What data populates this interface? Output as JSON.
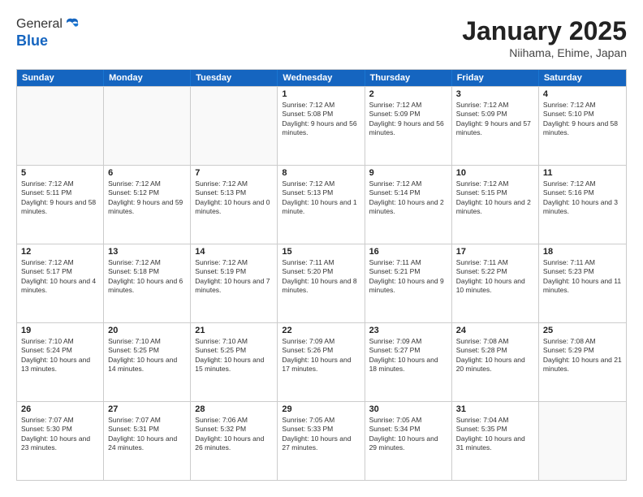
{
  "header": {
    "logo_general": "General",
    "logo_blue": "Blue",
    "month_title": "January 2025",
    "location": "Niihama, Ehime, Japan"
  },
  "days_of_week": [
    "Sunday",
    "Monday",
    "Tuesday",
    "Wednesday",
    "Thursday",
    "Friday",
    "Saturday"
  ],
  "weeks": [
    [
      {
        "day": "",
        "empty": true
      },
      {
        "day": "",
        "empty": true
      },
      {
        "day": "",
        "empty": true
      },
      {
        "day": "1",
        "sunrise": "7:12 AM",
        "sunset": "5:08 PM",
        "daylight": "9 hours and 56 minutes."
      },
      {
        "day": "2",
        "sunrise": "7:12 AM",
        "sunset": "5:09 PM",
        "daylight": "9 hours and 56 minutes."
      },
      {
        "day": "3",
        "sunrise": "7:12 AM",
        "sunset": "5:09 PM",
        "daylight": "9 hours and 57 minutes."
      },
      {
        "day": "4",
        "sunrise": "7:12 AM",
        "sunset": "5:10 PM",
        "daylight": "9 hours and 58 minutes."
      }
    ],
    [
      {
        "day": "5",
        "sunrise": "7:12 AM",
        "sunset": "5:11 PM",
        "daylight": "9 hours and 58 minutes."
      },
      {
        "day": "6",
        "sunrise": "7:12 AM",
        "sunset": "5:12 PM",
        "daylight": "9 hours and 59 minutes."
      },
      {
        "day": "7",
        "sunrise": "7:12 AM",
        "sunset": "5:13 PM",
        "daylight": "10 hours and 0 minutes."
      },
      {
        "day": "8",
        "sunrise": "7:12 AM",
        "sunset": "5:13 PM",
        "daylight": "10 hours and 1 minute."
      },
      {
        "day": "9",
        "sunrise": "7:12 AM",
        "sunset": "5:14 PM",
        "daylight": "10 hours and 2 minutes."
      },
      {
        "day": "10",
        "sunrise": "7:12 AM",
        "sunset": "5:15 PM",
        "daylight": "10 hours and 2 minutes."
      },
      {
        "day": "11",
        "sunrise": "7:12 AM",
        "sunset": "5:16 PM",
        "daylight": "10 hours and 3 minutes."
      }
    ],
    [
      {
        "day": "12",
        "sunrise": "7:12 AM",
        "sunset": "5:17 PM",
        "daylight": "10 hours and 4 minutes."
      },
      {
        "day": "13",
        "sunrise": "7:12 AM",
        "sunset": "5:18 PM",
        "daylight": "10 hours and 6 minutes."
      },
      {
        "day": "14",
        "sunrise": "7:12 AM",
        "sunset": "5:19 PM",
        "daylight": "10 hours and 7 minutes."
      },
      {
        "day": "15",
        "sunrise": "7:11 AM",
        "sunset": "5:20 PM",
        "daylight": "10 hours and 8 minutes."
      },
      {
        "day": "16",
        "sunrise": "7:11 AM",
        "sunset": "5:21 PM",
        "daylight": "10 hours and 9 minutes."
      },
      {
        "day": "17",
        "sunrise": "7:11 AM",
        "sunset": "5:22 PM",
        "daylight": "10 hours and 10 minutes."
      },
      {
        "day": "18",
        "sunrise": "7:11 AM",
        "sunset": "5:23 PM",
        "daylight": "10 hours and 11 minutes."
      }
    ],
    [
      {
        "day": "19",
        "sunrise": "7:10 AM",
        "sunset": "5:24 PM",
        "daylight": "10 hours and 13 minutes."
      },
      {
        "day": "20",
        "sunrise": "7:10 AM",
        "sunset": "5:25 PM",
        "daylight": "10 hours and 14 minutes."
      },
      {
        "day": "21",
        "sunrise": "7:10 AM",
        "sunset": "5:25 PM",
        "daylight": "10 hours and 15 minutes."
      },
      {
        "day": "22",
        "sunrise": "7:09 AM",
        "sunset": "5:26 PM",
        "daylight": "10 hours and 17 minutes."
      },
      {
        "day": "23",
        "sunrise": "7:09 AM",
        "sunset": "5:27 PM",
        "daylight": "10 hours and 18 minutes."
      },
      {
        "day": "24",
        "sunrise": "7:08 AM",
        "sunset": "5:28 PM",
        "daylight": "10 hours and 20 minutes."
      },
      {
        "day": "25",
        "sunrise": "7:08 AM",
        "sunset": "5:29 PM",
        "daylight": "10 hours and 21 minutes."
      }
    ],
    [
      {
        "day": "26",
        "sunrise": "7:07 AM",
        "sunset": "5:30 PM",
        "daylight": "10 hours and 23 minutes."
      },
      {
        "day": "27",
        "sunrise": "7:07 AM",
        "sunset": "5:31 PM",
        "daylight": "10 hours and 24 minutes."
      },
      {
        "day": "28",
        "sunrise": "7:06 AM",
        "sunset": "5:32 PM",
        "daylight": "10 hours and 26 minutes."
      },
      {
        "day": "29",
        "sunrise": "7:05 AM",
        "sunset": "5:33 PM",
        "daylight": "10 hours and 27 minutes."
      },
      {
        "day": "30",
        "sunrise": "7:05 AM",
        "sunset": "5:34 PM",
        "daylight": "10 hours and 29 minutes."
      },
      {
        "day": "31",
        "sunrise": "7:04 AM",
        "sunset": "5:35 PM",
        "daylight": "10 hours and 31 minutes."
      },
      {
        "day": "",
        "empty": true
      }
    ]
  ]
}
